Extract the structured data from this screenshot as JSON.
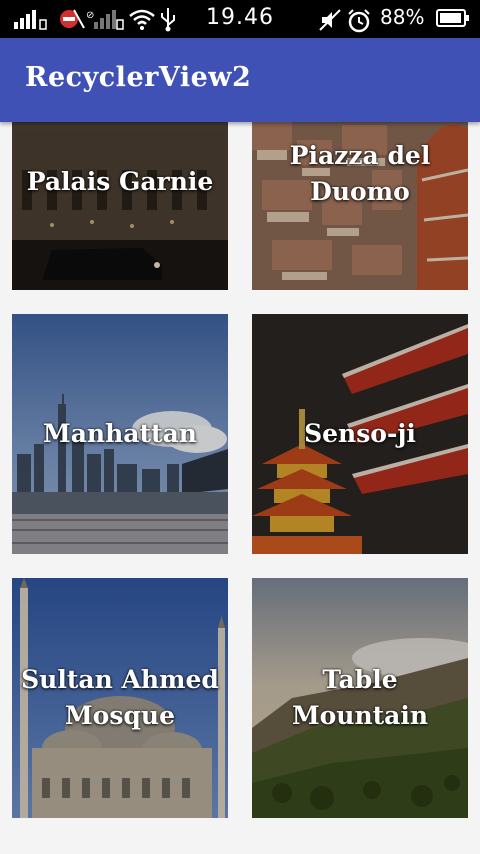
{
  "status_bar": {
    "time": "19.46",
    "battery_percent": "88%",
    "icons": [
      "signal-icon",
      "no-sim-icon",
      "signal-icon",
      "wifi-icon",
      "usb-icon",
      "mute-icon",
      "alarm-icon",
      "battery-icon"
    ]
  },
  "app_bar": {
    "title": "RecyclerView2"
  },
  "cards": [
    {
      "label": "Palais Garnie"
    },
    {
      "label": "Piazza del Duomo"
    },
    {
      "label": "Manhattan"
    },
    {
      "label": "Senso-ji"
    },
    {
      "label": "Sultan Ahmed Mosque"
    },
    {
      "label": "Table Mountain"
    }
  ],
  "colors": {
    "primary": "#3f51b5",
    "status_bar": "#000000",
    "background": "#f4f4f4"
  }
}
